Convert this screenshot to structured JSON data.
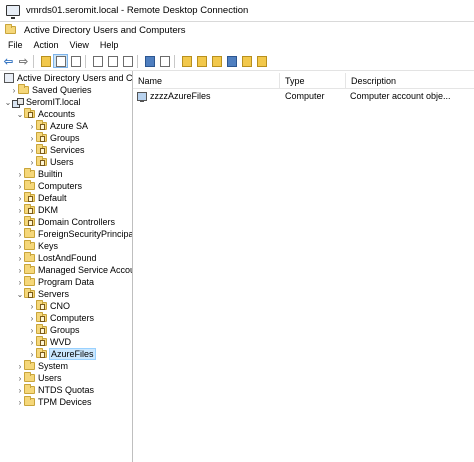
{
  "rdp": {
    "title": "vmrds01.seromit.local - Remote Desktop Connection"
  },
  "app": {
    "title": "Active Directory Users and Computers"
  },
  "menu": [
    "File",
    "Action",
    "View",
    "Help"
  ],
  "toolbar": {
    "icons": [
      "back-arrow-icon",
      "forward-arrow-icon",
      "up-folder-icon",
      "show-tree-icon",
      "console-icon",
      "copy-icon",
      "export-list-icon",
      "refresh-icon",
      "help-icon",
      "properties-icon",
      "new-user-icon",
      "new-group-icon",
      "new-ou-icon",
      "filter-icon",
      "find-icon",
      "add-to-group-icon"
    ]
  },
  "tree": {
    "root": "Active Directory Users and Com",
    "saved_queries": "Saved Queries",
    "domain": "SeromIT.local",
    "accounts": "Accounts",
    "azure_sa": "Azure SA",
    "groups": "Groups",
    "services": "Services",
    "users": "Users",
    "builtin": "Builtin",
    "computers": "Computers",
    "default": "Default",
    "dkm": "DKM",
    "domain_controllers": "Domain Controllers",
    "foreign": "ForeignSecurityPrincipals",
    "keys": "Keys",
    "lostandfound": "LostAndFound",
    "msa": "Managed Service Accour",
    "program_data": "Program Data",
    "servers": "Servers",
    "cno": "CNO",
    "srv_computers": "Computers",
    "srv_groups": "Groups",
    "wvd": "WVD",
    "azurefiles": "AzureFiles",
    "system": "System",
    "tree_users": "Users",
    "ntds": "NTDS Quotas",
    "tpm": "TPM Devices"
  },
  "list": {
    "headers": {
      "name": "Name",
      "type": "Type",
      "description": "Description"
    },
    "rows": [
      {
        "name": "zzzzAzureFiles",
        "type": "Computer",
        "description": "Computer account obje..."
      }
    ]
  }
}
